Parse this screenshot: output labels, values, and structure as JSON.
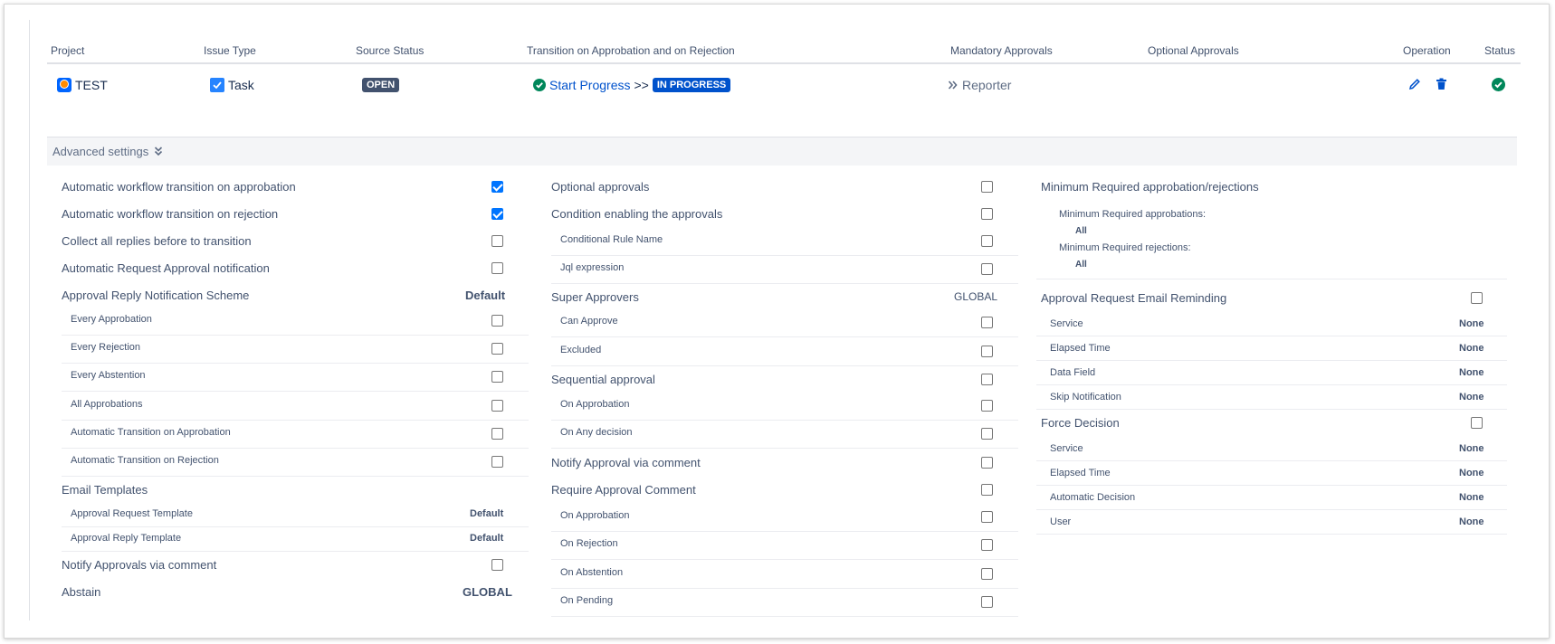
{
  "table": {
    "headers": {
      "project": "Project",
      "issue_type": "Issue Type",
      "source_status": "Source Status",
      "transition": "Transition on Approbation and on Rejection",
      "mandatory": "Mandatory Approvals",
      "optional": "Optional Approvals",
      "operation": "Operation",
      "status": "Status"
    },
    "row": {
      "project": "TEST",
      "issue_type": "Task",
      "source_status": "OPEN",
      "transition_name": "Start Progress",
      "transition_arrow": ">>",
      "target_status": "IN PROGRESS",
      "mandatory": "Reporter"
    }
  },
  "advanced": {
    "label": "Advanced settings"
  },
  "col1": {
    "r1": "Automatic workflow transition on approbation",
    "r2": "Automatic workflow transition on rejection",
    "r3": "Collect all replies before to transition",
    "r4": "Automatic Request Approval notification",
    "r5": "Approval Reply Notification Scheme",
    "r5_val": "Default",
    "s1": "Every Approbation",
    "s2": "Every Rejection",
    "s3": "Every Abstention",
    "s4": "All Approbations",
    "s5": "Automatic Transition on Approbation",
    "s6": "Automatic Transition on Rejection",
    "r6": "Email Templates",
    "t1": "Approval Request Template",
    "t1_val": "Default",
    "t2": "Approval Reply Template",
    "t2_val": "Default",
    "r7": "Notify Approvals via comment",
    "r8": "Abstain",
    "r8_val": "GLOBAL"
  },
  "col2": {
    "r1": "Optional approvals",
    "r2": "Condition enabling the approvals",
    "s1": "Conditional Rule Name",
    "s2": "Jql expression",
    "r3": "Super Approvers",
    "r3_val": "GLOBAL",
    "s3": "Can Approve",
    "s4": "Excluded",
    "r4": "Sequential approval",
    "s5": "On Approbation",
    "s6": "On Any decision",
    "r5": "Notify Approval via comment",
    "r6": "Require Approval Comment",
    "s7": "On Approbation",
    "s8": "On Rejection",
    "s9": "On Abstention",
    "s10": "On Pending"
  },
  "col3": {
    "r1": "Minimum Required approbation/rejections",
    "m1": "Minimum Required approbations:",
    "m1_val": "All",
    "m2": "Minimum Required rejections:",
    "m2_val": "All",
    "r2": "Approval Request Email Reminding",
    "a1": "Service",
    "a1_val": "None",
    "a2": "Elapsed Time",
    "a2_val": "None",
    "a3": "Data Field",
    "a3_val": "None",
    "a4": "Skip Notification",
    "a4_val": "None",
    "r3": "Force Decision",
    "f1": "Service",
    "f1_val": "None",
    "f2": "Elapsed Time",
    "f2_val": "None",
    "f3": "Automatic Decision",
    "f3_val": "None",
    "f4": "User",
    "f4_val": "None"
  },
  "checkboxes": {
    "col1_r1": true,
    "col1_r2": true,
    "col1_r3": false,
    "col1_r4": false,
    "col1_s1": false,
    "col1_s2": false,
    "col1_s3": false,
    "col1_s4": false,
    "col1_s5": false,
    "col1_s6": false,
    "col1_r7": false,
    "col2_r1": false,
    "col2_r2": false,
    "col2_s1": false,
    "col2_s2": false,
    "col2_s3": false,
    "col2_s4": false,
    "col2_r4": false,
    "col2_s5": false,
    "col2_s6": false,
    "col2_r5": false,
    "col2_r6": false,
    "col2_s7": false,
    "col2_s8": false,
    "col2_s9": false,
    "col2_s10": false,
    "col3_r2": false,
    "col3_r3": false
  },
  "colors": {
    "accent": "#0052cc",
    "checkbox": "#0075ff",
    "success": "#00875a",
    "muted": "#42526e"
  },
  "icons": {
    "edit": "pencil-icon",
    "delete": "trash-icon",
    "status": "check-circle-icon",
    "expand": "double-chevron-down-icon"
  }
}
